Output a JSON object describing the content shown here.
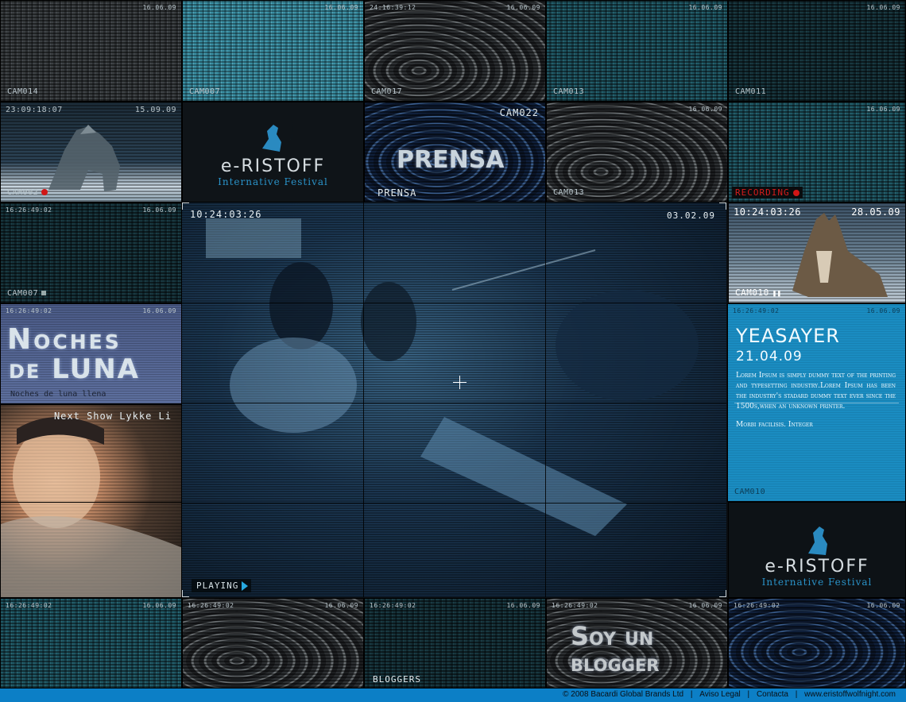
{
  "tiles": {
    "r1c1": {
      "date": "16.06.09",
      "cam": "CAM014"
    },
    "r1c2": {
      "date": "16.06.09",
      "cam": "CAM007"
    },
    "r1c3": {
      "time": "24:16:39:12",
      "date": "16.06.09",
      "cam": "CAM017"
    },
    "r1c4": {
      "date": "16.06.09",
      "cam": "CAM013"
    },
    "r1c5": {
      "date": "16.06.09",
      "cam": "CAM011"
    },
    "r2c1": {
      "time": "23:09:18:07",
      "date": "15.09.09",
      "cam": "CAM002"
    },
    "r2c2": {
      "logo_name": "e-RISTOFF",
      "logo_sub": "Internative Festival"
    },
    "r2c3": {
      "cam": "CAM022",
      "headline": "PRENSA",
      "label": "PRENSA"
    },
    "r2c4": {
      "date": "16.06.09",
      "cam": "CAM013"
    },
    "r2c5": {
      "date": "16.06.09",
      "status": "RECORDING"
    },
    "r3c1": {
      "time": "16:26:49:02",
      "date": "16.06.09",
      "cam": "CAM007"
    },
    "r3c5": {
      "time": "10:24:03:26",
      "date": "28.05.09",
      "cam": "CAM010"
    },
    "r4c1": {
      "time": "16:26:49:02",
      "date": "16.06.09",
      "line1": "Noches",
      "line2": "de LUNA",
      "caption": "Noches de luna llena"
    },
    "r5c1": {
      "caption": "Next Show Lykke Li"
    },
    "r6c5": {
      "logo_name": "e-RISTOFF",
      "logo_sub": "Internative Festival"
    },
    "r7c1": {
      "time": "16:26:49:02",
      "date": "16.06.09"
    },
    "r7c2": {
      "time": "16:26:49:02",
      "date": "16.06.09"
    },
    "r7c3": {
      "time": "16:26:49:02",
      "date": "16.06.09",
      "label": "BLOGGERS"
    },
    "r7c4": {
      "time": "16:26:49:02",
      "date": "16.06.09",
      "line1": "Soy un",
      "line2": "blogger"
    },
    "r7c5": {
      "time": "16:26:49:02",
      "date": "16.06.09"
    }
  },
  "main": {
    "time": "10:24:03:26",
    "date": "03.02.09",
    "status": "PLAYING"
  },
  "promo": {
    "time": "16:26:49:02",
    "date_top": "16.06.09",
    "title": "YEASAYER",
    "date": "21.04.09",
    "body1": "Lorem Ipsum is simply dummy text of the printing and typesetting industry.Lorem Ipsum has been the industry's stadard dummy text ever since the 1500s,when an unknown printer.",
    "body2": "Morbi facilisis. Integer",
    "cam": "CAM010"
  },
  "footer": {
    "copyright": "© 2008 Bacardi Global Brands Ltd",
    "sep": "|",
    "legal": "Aviso Legal",
    "contact": "Contacta",
    "site": "www.eristoffwolfnight.com"
  },
  "colors": {
    "accent": "#0c7fc6",
    "promo_bg": "#1a8cc1",
    "record": "#d11616"
  }
}
